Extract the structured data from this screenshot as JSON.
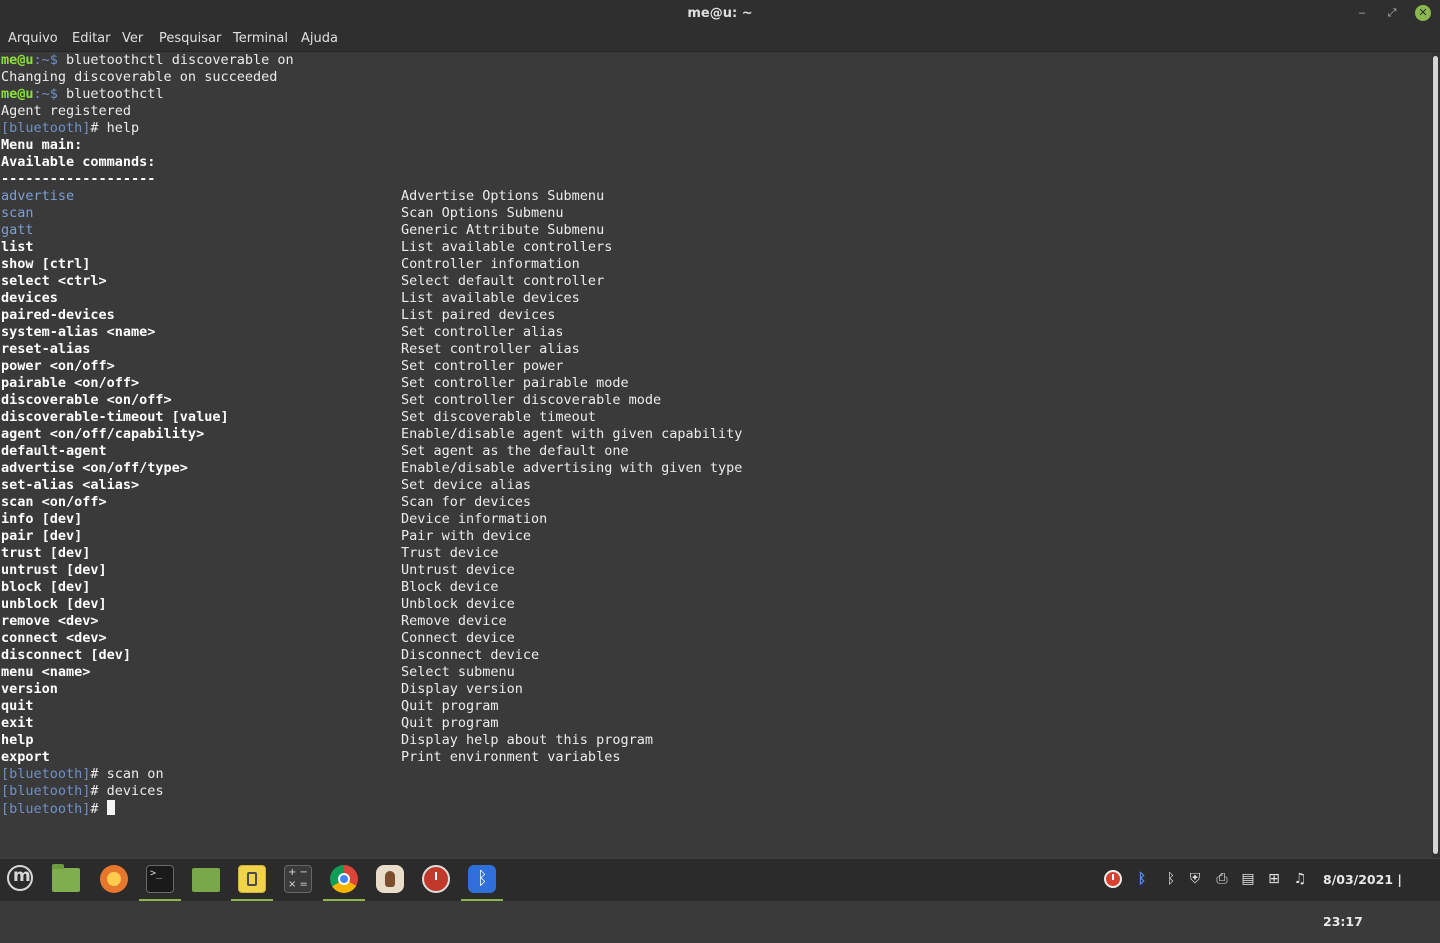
{
  "window": {
    "title": "me@u: ~",
    "minimize_icon": "minimize-icon",
    "maximize_icon": "maximize-icon",
    "close_icon": "close-icon"
  },
  "menubar": {
    "items": [
      "Arquivo",
      "Editar",
      "Ver",
      "Pesquisar",
      "Terminal",
      "Ajuda"
    ]
  },
  "terminal": {
    "prompt_user": "me@u",
    "prompt_path": ":~$",
    "cmd1": " bluetoothctl discoverable on",
    "out1": "Changing discoverable on succeeded",
    "cmd2": " bluetoothctl",
    "out2": "Agent registered",
    "bt_prompt": "[bluetooth]",
    "bt_hash": "# ",
    "cmd3": "help",
    "menu_main": "Menu main:",
    "available": "Available commands:",
    "separator": "-------------------",
    "commands": [
      {
        "cmd": "advertise",
        "desc": "Advertise Options Submenu"
      },
      {
        "cmd": "scan",
        "desc": "Scan Options Submenu"
      },
      {
        "cmd": "gatt",
        "desc": "Generic Attribute Submenu"
      },
      {
        "cmd": "list",
        "desc": "List available controllers"
      },
      {
        "cmd": "show [ctrl]",
        "desc": "Controller information"
      },
      {
        "cmd": "select <ctrl>",
        "desc": "Select default controller"
      },
      {
        "cmd": "devices",
        "desc": "List available devices"
      },
      {
        "cmd": "paired-devices",
        "desc": "List paired devices"
      },
      {
        "cmd": "system-alias <name>",
        "desc": "Set controller alias"
      },
      {
        "cmd": "reset-alias",
        "desc": "Reset controller alias"
      },
      {
        "cmd": "power <on/off>",
        "desc": "Set controller power"
      },
      {
        "cmd": "pairable <on/off>",
        "desc": "Set controller pairable mode"
      },
      {
        "cmd": "discoverable <on/off>",
        "desc": "Set controller discoverable mode"
      },
      {
        "cmd": "discoverable-timeout [value]",
        "desc": "Set discoverable timeout"
      },
      {
        "cmd": "agent <on/off/capability>",
        "desc": "Enable/disable agent with given capability"
      },
      {
        "cmd": "default-agent",
        "desc": "Set agent as the default one"
      },
      {
        "cmd": "advertise <on/off/type>",
        "desc": "Enable/disable advertising with given type"
      },
      {
        "cmd": "set-alias <alias>",
        "desc": "Set device alias"
      },
      {
        "cmd": "scan <on/off>",
        "desc": "Scan for devices"
      },
      {
        "cmd": "info [dev]",
        "desc": "Device information"
      },
      {
        "cmd": "pair [dev]",
        "desc": "Pair with device"
      },
      {
        "cmd": "trust [dev]",
        "desc": "Trust device"
      },
      {
        "cmd": "untrust [dev]",
        "desc": "Untrust device"
      },
      {
        "cmd": "block [dev]",
        "desc": "Block device"
      },
      {
        "cmd": "unblock [dev]",
        "desc": "Unblock device"
      },
      {
        "cmd": "remove <dev>",
        "desc": "Remove device"
      },
      {
        "cmd": "connect <dev>",
        "desc": "Connect device"
      },
      {
        "cmd": "disconnect [dev]",
        "desc": "Disconnect device"
      },
      {
        "cmd": "menu <name>",
        "desc": "Select submenu"
      },
      {
        "cmd": "version",
        "desc": "Display version"
      },
      {
        "cmd": "quit",
        "desc": "Quit program"
      },
      {
        "cmd": "exit",
        "desc": "Quit program"
      },
      {
        "cmd": "help",
        "desc": "Display help about this program"
      },
      {
        "cmd": "export",
        "desc": "Print environment variables"
      }
    ],
    "cmd4": "scan on",
    "cmd5": "devices"
  },
  "taskbar": {
    "apps": [
      {
        "icon": "mint-menu-icon"
      },
      {
        "icon": "show-desktop-folder-icon"
      },
      {
        "icon": "firefox-icon"
      },
      {
        "icon": "terminal-icon"
      },
      {
        "icon": "files-folder-icon"
      },
      {
        "icon": "notes-icon"
      },
      {
        "icon": "calculator-icon"
      },
      {
        "icon": "chrome-icon"
      },
      {
        "icon": "hand-app-icon"
      },
      {
        "icon": "alarm-clock-icon"
      },
      {
        "icon": "bluetooth-app-icon"
      }
    ],
    "tray": [
      "clock-applet-icon",
      "bluetooth-tray-icon",
      "bluetooth-icon",
      "shield-icon",
      "printer-icon",
      "document-icon",
      "network-icon",
      "music-note-icon"
    ],
    "clock": "8/03/2021 | 23:17"
  },
  "colors": {
    "terminal_bg": "#3a3a3a",
    "prompt_green": "#8ae234",
    "bt_prompt_blue": "#6f91c8",
    "accent": "#8ab84d"
  }
}
